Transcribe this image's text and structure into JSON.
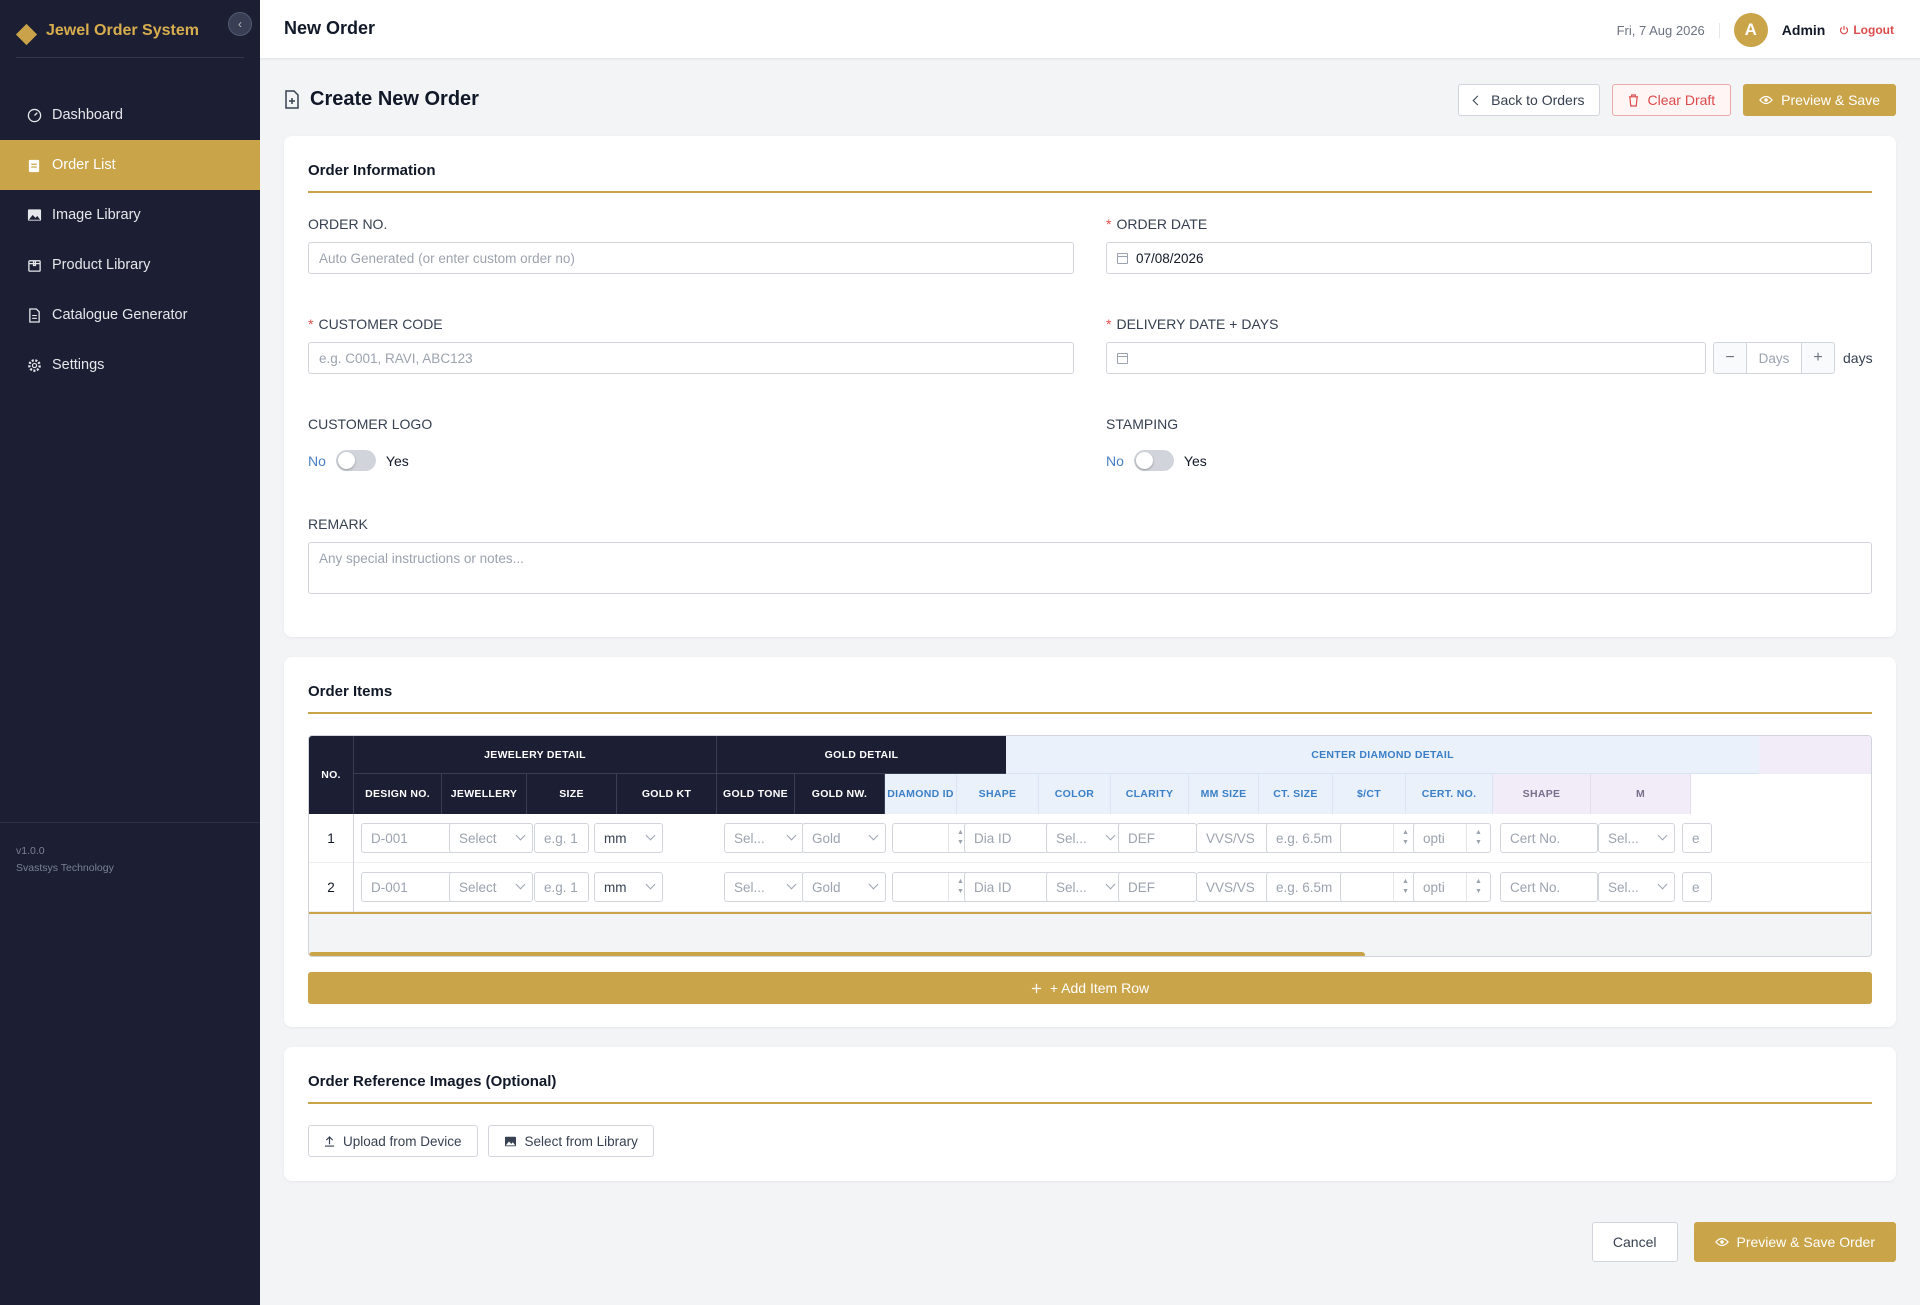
{
  "sidebar": {
    "brand": "Jewel Order System",
    "items": [
      {
        "label": "Dashboard",
        "icon": "dashboard-icon"
      },
      {
        "label": "Order List",
        "icon": "clipboard-icon",
        "active": true
      },
      {
        "label": "Image Library",
        "icon": "image-icon"
      },
      {
        "label": "Product Library",
        "icon": "package-icon"
      },
      {
        "label": "Catalogue Generator",
        "icon": "document-icon"
      },
      {
        "label": "Settings",
        "icon": "gear-icon"
      }
    ],
    "version": "v1.0.0",
    "company": "Svastsys Technology"
  },
  "topbar": {
    "title": "New Order",
    "date": "Fri, 7 Aug 2026",
    "avatar_initial": "A",
    "user": "Admin",
    "logout": "Logout"
  },
  "page": {
    "heading": "Create New Order",
    "back_button": "Back to Orders",
    "clear_button": "Clear Draft",
    "preview_button": "Preview & Save"
  },
  "order_info": {
    "title": "Order Information",
    "order_no_label": "ORDER NO.",
    "order_no_placeholder": "Auto Generated (or enter custom order no)",
    "order_date_label": "ORDER DATE",
    "order_date_value": "07/08/2026",
    "customer_code_label": "CUSTOMER CODE",
    "customer_code_placeholder": "e.g. C001, RAVI, ABC123",
    "delivery_label": "DELIVERY DATE + DAYS",
    "days_minus": "−",
    "days_placeholder": "Days",
    "days_plus": "+",
    "days_suffix": "days",
    "customer_logo_label": "CUSTOMER LOGO",
    "stamping_label": "STAMPING",
    "toggle_no": "No",
    "toggle_yes": "Yes",
    "remark_label": "REMARK",
    "remark_placeholder": "Any special instructions or notes..."
  },
  "order_items": {
    "title": "Order Items",
    "group_headers": {
      "no": "NO.",
      "jewellery_detail": "JEWELERY DETAIL",
      "gold_detail": "GOLD DETAIL",
      "center_diamond": "CENTER DIAMOND DETAIL"
    },
    "columns": [
      "DESIGN NO.",
      "JEWELLERY",
      "SIZE",
      "GOLD KT",
      "GOLD TONE",
      "GOLD NW.",
      "DIAMOND ID",
      "SHAPE",
      "COLOR",
      "CLARITY",
      "MM SIZE",
      "CT. SIZE",
      "$/CT",
      "CERT. NO.",
      "SHAPE",
      "M"
    ],
    "rows": [
      {
        "no": "1",
        "design": "D-001",
        "jewellery": "Select",
        "size": "e.g. 1",
        "unit": "mm",
        "gold_kt": "Sel...",
        "gold_tone": "Gold",
        "diamond_id": "Dia ID",
        "shape": "Sel...",
        "color": "DEF",
        "clarity": "VVS/VS",
        "mm_size": "e.g. 6.5m",
        "per_ct": "opti",
        "cert": "Cert No.",
        "shape2": "Sel...",
        "extra": "e"
      },
      {
        "no": "2",
        "design": "D-001",
        "jewellery": "Select",
        "size": "e.g. 1",
        "unit": "mm",
        "gold_kt": "Sel...",
        "gold_tone": "Gold",
        "diamond_id": "Dia ID",
        "shape": "Sel...",
        "color": "DEF",
        "clarity": "VVS/VS",
        "mm_size": "e.g. 6.5m",
        "per_ct": "opti",
        "cert": "Cert No.",
        "shape2": "Sel...",
        "extra": "e"
      }
    ],
    "add_row": "+ Add Item Row"
  },
  "reference_images": {
    "title": "Order Reference Images (Optional)",
    "upload": "Upload from Device",
    "library": "Select from Library"
  },
  "footer": {
    "cancel": "Cancel",
    "save": "Preview & Save Order"
  }
}
